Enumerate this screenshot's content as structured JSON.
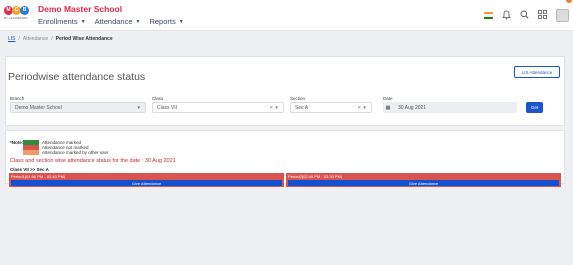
{
  "header": {
    "logo_letters": [
      "M",
      "C",
      "B"
    ],
    "logo_caption": "MY CLASSBOARD",
    "school_name": "Demo Master School",
    "nav": [
      {
        "label": "Enrollments"
      },
      {
        "label": "Attendance"
      },
      {
        "label": "Reports"
      }
    ],
    "icons": [
      "flag-icon",
      "bell-icon",
      "search-icon",
      "grid-icon",
      "avatar"
    ]
  },
  "breadcrumb": {
    "home": "LIS",
    "section": "Attendance",
    "current": "Period Wise Attendance",
    "separator": "/"
  },
  "page": {
    "title": "Periodwise attendance status",
    "lis_button": "LIS Attendance"
  },
  "filters": {
    "branch": {
      "label": "Branch",
      "value": "Demo Master School"
    },
    "class": {
      "label": "Class",
      "value": "Class VII"
    },
    "section": {
      "label": "Section",
      "value": "Sec A"
    },
    "date": {
      "label": "Date",
      "value": "30 Aug 2021"
    },
    "get_button": "Get"
  },
  "legend": {
    "note_label": "*Note:",
    "items": [
      {
        "label": "Attendance marked",
        "color": "#2e8b3a"
      },
      {
        "label": "Attendance not marked",
        "color": "#d9534f"
      },
      {
        "label": "Attendance marked by other user",
        "color": "#f09a6e"
      }
    ]
  },
  "status_text": "Class and section wise attendance status for the date : 30 Aug 2021",
  "class_section_label": "Class VII >> Sec A",
  "periods": [
    {
      "title": "Period1(01:50 PM - 02:40 PM)",
      "button": "Give Attendance"
    },
    {
      "title": "Period2(02:40 PM - 03:30 PM)",
      "button": "Give Attendance"
    }
  ]
}
